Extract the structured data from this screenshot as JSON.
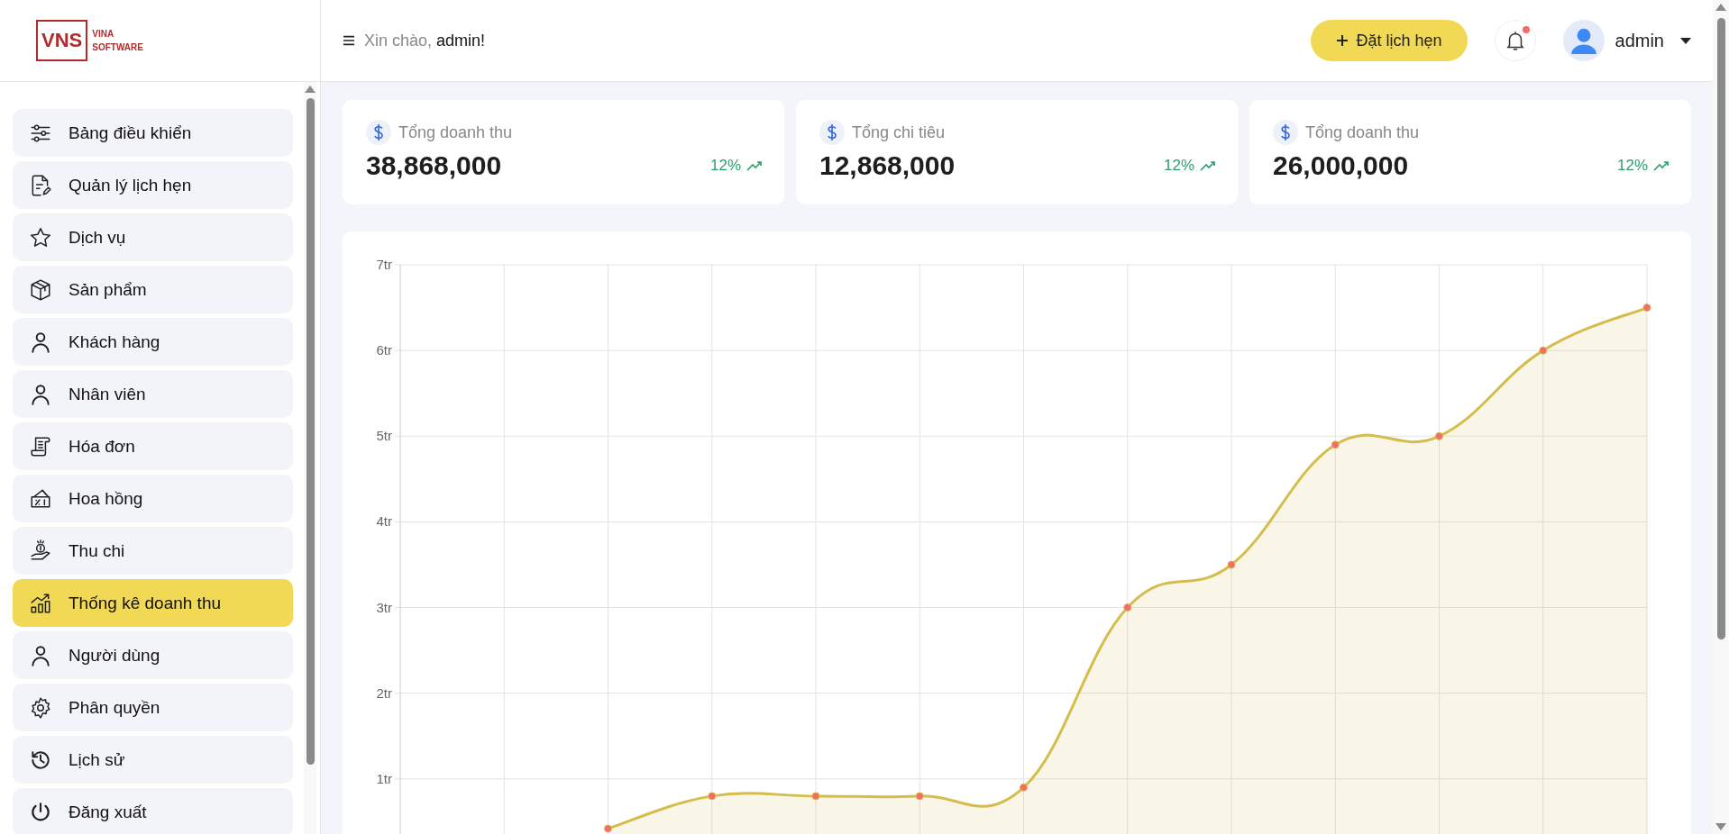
{
  "logo": {
    "mark": "VNS",
    "line1": "VINA",
    "line2": "SOFTWARE"
  },
  "header": {
    "greeting": "Xin chào,",
    "user_name": "admin!",
    "book_button": "Đặt lịch hẹn",
    "notification_unread": true,
    "account": "admin"
  },
  "sidebar": {
    "items": [
      {
        "label": "Bảng điều khiển",
        "selected": false
      },
      {
        "label": "Quản lý lịch hẹn",
        "selected": false
      },
      {
        "label": "Dịch vụ",
        "selected": false
      },
      {
        "label": "Sản phẩm",
        "selected": false
      },
      {
        "label": "Khách hàng",
        "selected": false
      },
      {
        "label": "Nhân viên",
        "selected": false
      },
      {
        "label": "Hóa đơn",
        "selected": false
      },
      {
        "label": "Hoa hồng",
        "selected": false
      },
      {
        "label": "Thu chi",
        "selected": false
      },
      {
        "label": "Thống kê doanh thu",
        "selected": true
      },
      {
        "label": "Người dùng",
        "selected": false
      },
      {
        "label": "Phân quyền",
        "selected": false
      },
      {
        "label": "Lịch sử",
        "selected": false
      },
      {
        "label": "Đăng xuất",
        "selected": false
      }
    ]
  },
  "stat_cards": [
    {
      "label": "Tổng doanh thu",
      "value": "38,868,000",
      "change": "12%"
    },
    {
      "label": "Tổng chi tiêu",
      "value": "12,868,000",
      "change": "12%"
    },
    {
      "label": "Tổng doanh thu",
      "value": "26,000,000",
      "change": "12%"
    }
  ],
  "revenue_chart": {
    "chart_data": {
      "type": "area",
      "ylim": [
        0,
        7
      ],
      "yticks": [
        {
          "value": 1,
          "label": "1tr"
        },
        {
          "value": 2,
          "label": "2tr"
        },
        {
          "value": 3,
          "label": "3tr"
        },
        {
          "value": 4,
          "label": "4tr"
        },
        {
          "value": 5,
          "label": "5tr"
        },
        {
          "value": 6,
          "label": "6tr"
        },
        {
          "value": 7,
          "label": "7tr"
        }
      ],
      "grid": true,
      "series": [
        {
          "color": "#d4bd4c",
          "values": [
            null,
            null,
            0.42,
            0.8,
            0.8,
            0.8,
            0.9,
            3,
            3.5,
            4.9,
            5,
            6,
            6.5
          ]
        }
      ]
    }
  }
}
